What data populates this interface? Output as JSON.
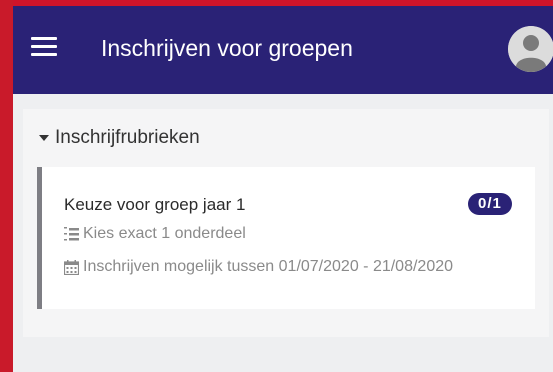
{
  "header": {
    "title": "Inschrijven voor groepen",
    "menu_icon": "hamburger-menu-icon",
    "avatar_icon": "user-avatar-icon"
  },
  "section": {
    "title": "Inschrijfrubrieken",
    "expanded": true
  },
  "card": {
    "title": "Keuze voor groep jaar 1",
    "badge": "0/1",
    "rule_text": "Kies exact 1 onderdeel",
    "rule_icon": "numbered-list-icon",
    "period_text": "Inschrijven mogelijk tussen 01/07/2020 - 21/08/2020",
    "period_icon": "calendar-icon"
  },
  "colors": {
    "appbar": "#2a2276",
    "badge": "#2a2276",
    "accent_border": "#d0142a",
    "card_left_border": "#7e7e84",
    "meta_text": "#8a8a8a"
  }
}
